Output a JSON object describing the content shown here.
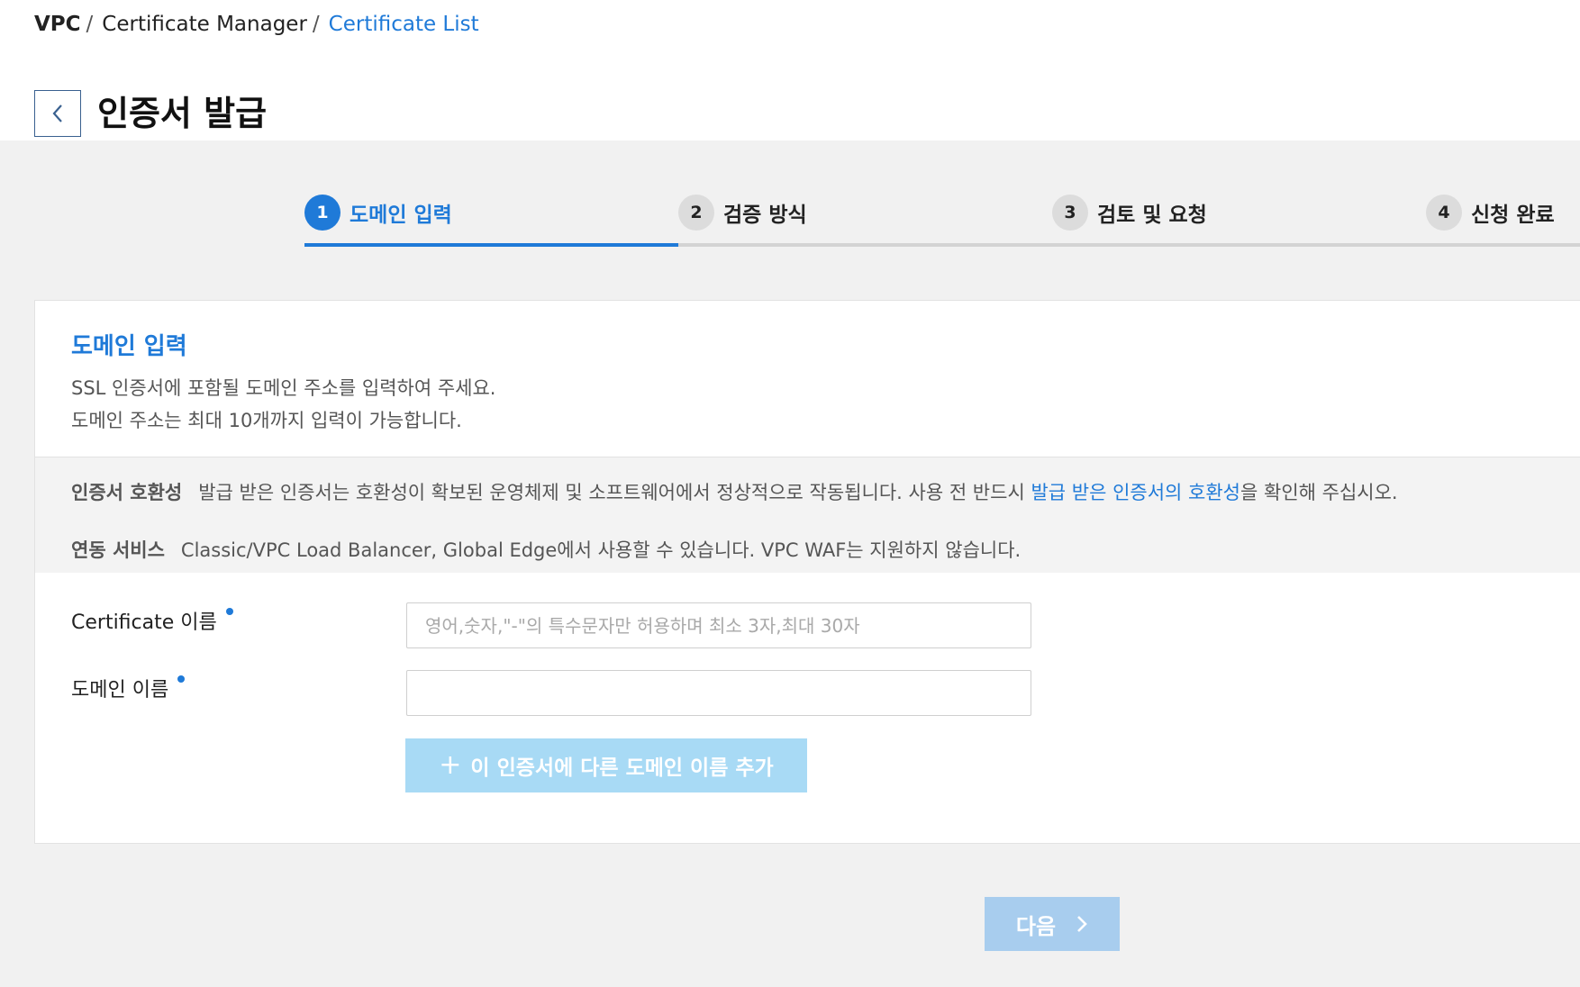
{
  "breadcrumb": {
    "items": [
      "VPC",
      "Certificate Manager",
      "Certificate List"
    ],
    "separator": "/"
  },
  "page": {
    "title": "인증서 발급",
    "back_icon": "chevron-left-icon"
  },
  "stepper": {
    "active_step": 1,
    "steps": [
      {
        "num": "1",
        "label": "도메인 입력"
      },
      {
        "num": "2",
        "label": "검증 방식"
      },
      {
        "num": "3",
        "label": "검토 및 요청"
      },
      {
        "num": "4",
        "label": "신청 완료"
      }
    ]
  },
  "section": {
    "title": "도메인 입력",
    "desc_line1": "SSL 인증서에 포함될 도메인 주소를 입력하여 주세요.",
    "desc_line2": "도메인 주소는 최대 10개까지 입력이 가능합니다."
  },
  "info": {
    "compat_key": "인증서 호환성",
    "compat_text_before": "발급 받은 인증서는 호환성이 확보된 운영체제 및 소프트웨어에서 정상적으로 작동됩니다. 사용 전 반드시 ",
    "compat_link": "발급 받은 인증서의 호환성",
    "compat_text_after": "을 확인해 주십시오.",
    "linked_key": "연동 서비스",
    "linked_text": "Classic/VPC Load Balancer, Global Edge에서 사용할 수 있습니다. VPC WAF는 지원하지 않습니다."
  },
  "form": {
    "cert_name_label": "Certificate 이름",
    "cert_name_placeholder": "영어,숫자,\"-\"의 특수문자만 허용하며 최소 3자,최대 30자",
    "cert_name_value": "",
    "domain_label": "도메인 이름",
    "domain_value": "",
    "add_domain_label": "이 인증서에 다른 도메인 이름 추가",
    "add_domain_icon": "plus-icon"
  },
  "footer": {
    "next_label": "다음",
    "next_icon": "chevron-right-icon"
  },
  "colors": {
    "accent": "#1f7ad8",
    "disabled_button": "#a8daf5",
    "next_disabled": "#a8cdee"
  }
}
